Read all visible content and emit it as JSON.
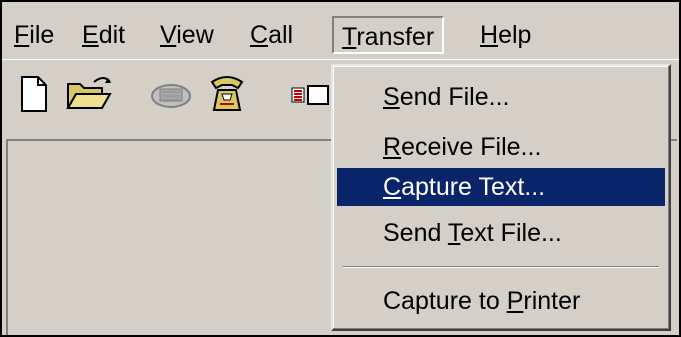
{
  "menubar": {
    "items": [
      {
        "accel": "F",
        "rest": "ile"
      },
      {
        "accel": "E",
        "rest": "dit"
      },
      {
        "accel": "V",
        "rest": "iew"
      },
      {
        "accel": "C",
        "rest": "all"
      },
      {
        "accel": "T",
        "rest": "ransfer"
      },
      {
        "accel": "H",
        "rest": "elp"
      }
    ]
  },
  "toolbar": {
    "icons": [
      "new-document-icon",
      "open-folder-icon",
      "disconnect-icon",
      "phone-call-icon",
      "properties-icon"
    ]
  },
  "transfer_menu": {
    "items": [
      {
        "pre": "",
        "accel": "S",
        "post": "end File..."
      },
      {
        "pre": "",
        "accel": "R",
        "post": "eceive File..."
      },
      {
        "pre": "",
        "accel": "C",
        "post": "apture Text..."
      },
      {
        "pre": "Send ",
        "accel": "T",
        "post": "ext File..."
      },
      {
        "pre": "Capture to ",
        "accel": "P",
        "post": "rinter"
      }
    ],
    "selected_index": 2,
    "highlight_color": "#0a246a"
  },
  "colors": {
    "face": "#d4d0c8",
    "shadow": "#808080",
    "highlight": "#ffffff"
  }
}
